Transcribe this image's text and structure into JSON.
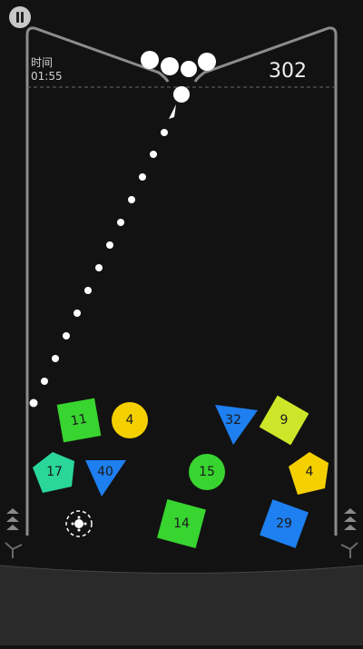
{
  "hud": {
    "timer_label": "时间",
    "timer_value": "01:55",
    "score": "302"
  },
  "colors": {
    "background": "#121212",
    "wall": "#9a9a9a",
    "ball": "#ffffff",
    "green": "#38d430",
    "yellow": "#f5d000",
    "blue": "#1e7ff0",
    "teal": "#2ad69a",
    "lime": "#cde62a"
  },
  "blocks": [
    {
      "id": "block-11",
      "shape": "square",
      "value": "11",
      "color": "#38d430"
    },
    {
      "id": "block-4a",
      "shape": "circle",
      "value": "4",
      "color": "#f5d000"
    },
    {
      "id": "block-32",
      "shape": "triangle",
      "value": "32",
      "color": "#1e7ff0"
    },
    {
      "id": "block-9",
      "shape": "square",
      "value": "9",
      "color": "#cde62a"
    },
    {
      "id": "block-17",
      "shape": "pentagon",
      "value": "17",
      "color": "#2ad69a"
    },
    {
      "id": "block-40",
      "shape": "triangle",
      "value": "40",
      "color": "#1e7ff0"
    },
    {
      "id": "block-15",
      "shape": "circle",
      "value": "15",
      "color": "#38d430"
    },
    {
      "id": "block-4b",
      "shape": "pentagon",
      "value": "4",
      "color": "#f5d000"
    },
    {
      "id": "block-14",
      "shape": "square",
      "value": "14",
      "color": "#38d430"
    },
    {
      "id": "block-29",
      "shape": "square",
      "value": "29",
      "color": "#1e7ff0"
    }
  ],
  "powerup": {
    "icon": "ball-target-icon"
  },
  "balls_in_hopper": 5
}
